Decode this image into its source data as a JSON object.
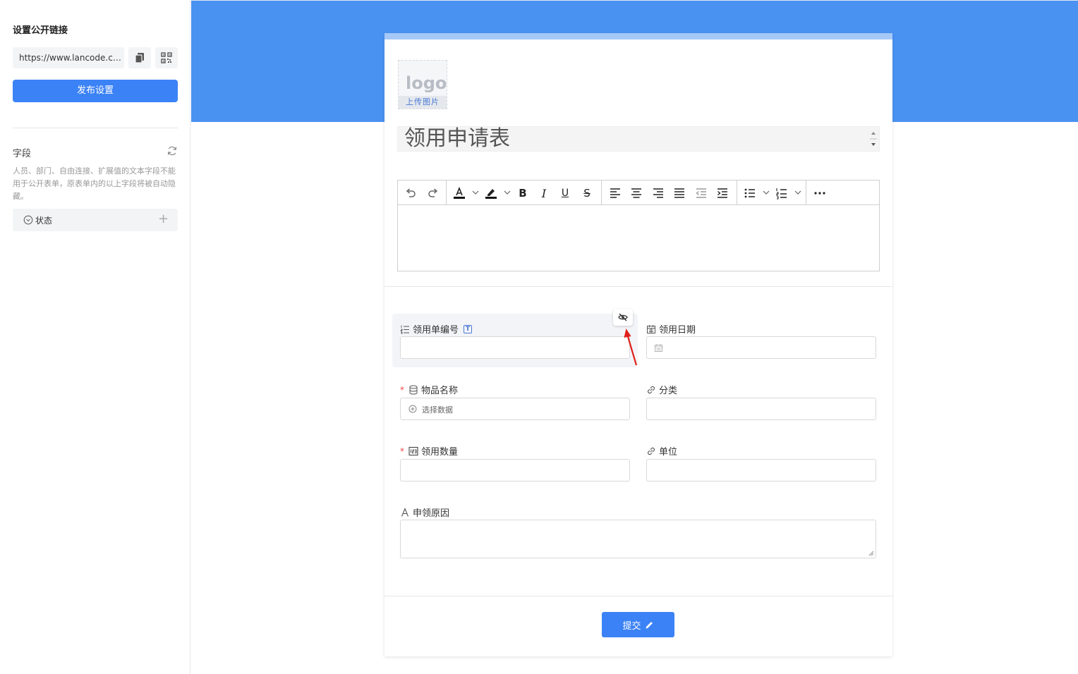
{
  "sidebar": {
    "title": "设置公开链接",
    "link_url": "https://www.lancode.cn...",
    "publish_label": "发布设置",
    "fields_label": "字段",
    "fields_desc": "人员、部门、自由连接、扩展值的文本字段不能用于公开表单，原表单内的以上字段将被自动隐藏。",
    "status_chip": "状态"
  },
  "form": {
    "logo_text": "logo",
    "logo_upload": "上传图片",
    "title": "领用申请表",
    "fields": {
      "order_no": "领用单编号",
      "order_no_badge": "T",
      "date": "领用日期",
      "item_name": "物品名称",
      "item_placeholder": "选择数据",
      "category": "分类",
      "quantity": "领用数量",
      "unit": "单位",
      "reason": "申领原因"
    },
    "required_mark": "*",
    "submit_label": "提交"
  },
  "colors": {
    "banner": "#4a92f2",
    "primary": "#3b82f6",
    "required": "#f04848",
    "arrow": "#e0201a"
  }
}
